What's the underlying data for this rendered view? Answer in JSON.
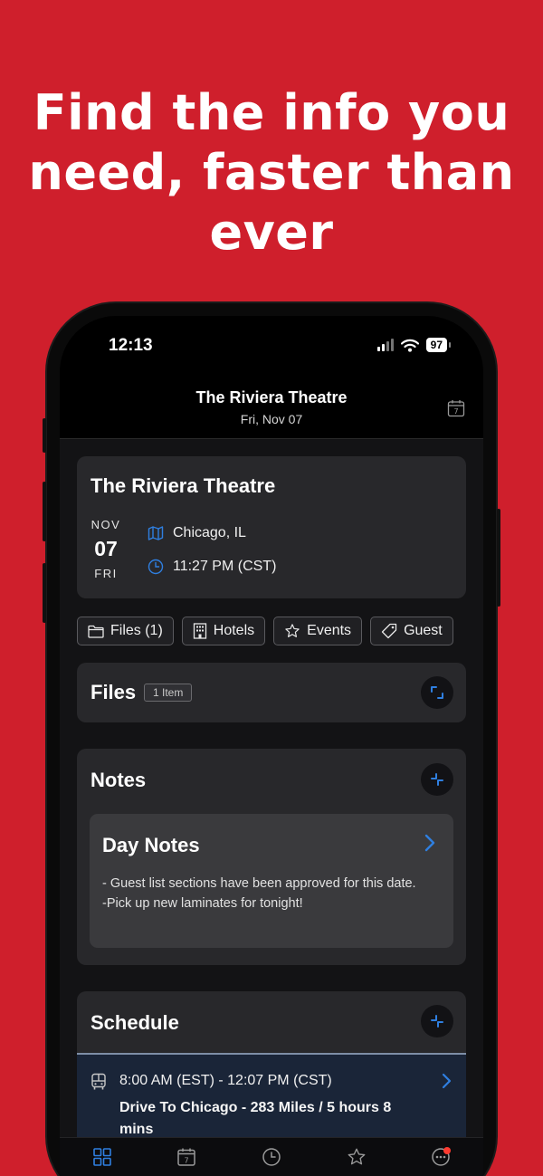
{
  "headline": "Find the info you need, faster than ever",
  "status": {
    "time": "12:13",
    "battery": "97"
  },
  "nav": {
    "title": "The Riviera Theatre",
    "subtitle": "Fri, Nov 07",
    "calendar_icon_day": "7"
  },
  "venue": {
    "name": "The Riviera Theatre",
    "month": "NOV",
    "day": "07",
    "weekday": "FRI",
    "location": "Chicago, IL",
    "time": "11:27 PM (CST)"
  },
  "chips": [
    {
      "label": "Files (1)",
      "icon": "folder-icon"
    },
    {
      "label": "Hotels",
      "icon": "building-icon"
    },
    {
      "label": "Events",
      "icon": "star-icon"
    },
    {
      "label": "Guest",
      "icon": "ticket-icon"
    }
  ],
  "files": {
    "title": "Files",
    "badge": "1 Item"
  },
  "notes": {
    "title": "Notes",
    "day_notes_title": "Day Notes",
    "line1": "- Guest list sections have been approved for this date.",
    "line2": "-Pick up new laminates for tonight!"
  },
  "schedule": {
    "title": "Schedule",
    "item_time": "8:00 AM (EST) - 12:07 PM (CST)",
    "item_desc": "Drive To Chicago - 283 Miles / 5 hours 8 mins"
  },
  "tabbar": [
    {
      "name": "dashboard",
      "icon": "grid-icon",
      "active": true
    },
    {
      "name": "calendar",
      "icon": "calendar-icon",
      "day": "7"
    },
    {
      "name": "recent",
      "icon": "clock-icon"
    },
    {
      "name": "favorites",
      "icon": "star-icon"
    },
    {
      "name": "more",
      "icon": "more-icon",
      "has_notification": true
    }
  ],
  "colors": {
    "background": "#cf1f2c",
    "accent": "#2f7fe0",
    "card": "#28282b"
  }
}
